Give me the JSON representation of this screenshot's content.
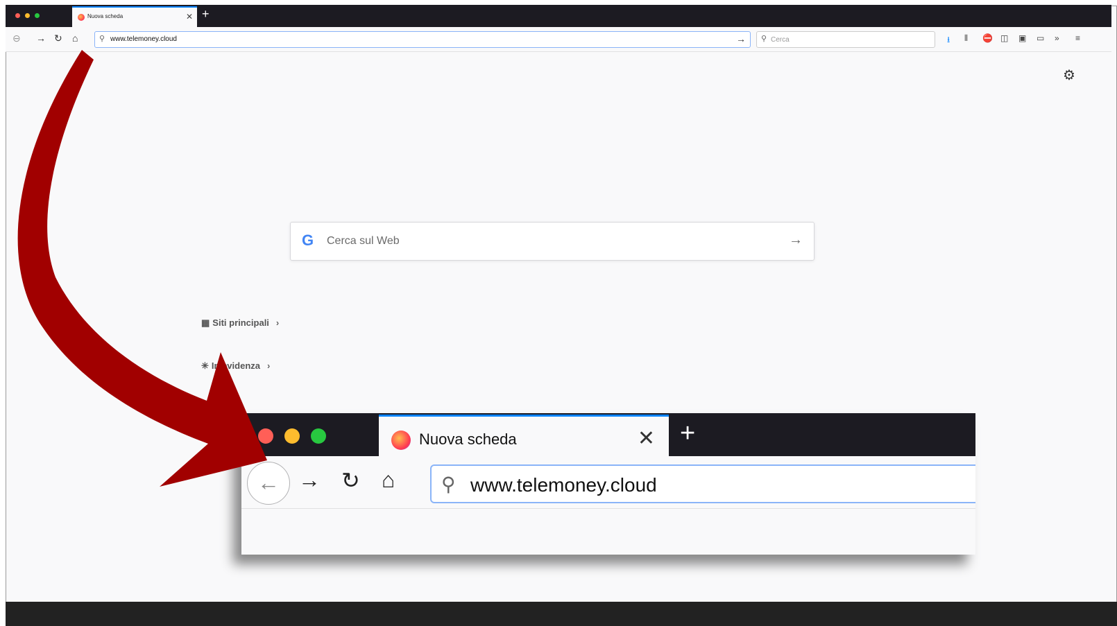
{
  "colors": {
    "accent": "#0a84ff",
    "arrow": "#a10000",
    "tabbar": "#1c1b22"
  },
  "browser": {
    "tab_title": "Nuova scheda",
    "url": "www.telemoney.cloud",
    "search_placeholder": "Cerca"
  },
  "newtab": {
    "web_search_placeholder": "Cerca sul Web",
    "google_logo": "G",
    "sections": [
      {
        "label": "Siti principali",
        "icon": "grid-icon"
      },
      {
        "label": "In evidenza",
        "icon": "highlights-icon"
      }
    ]
  },
  "zoom": {
    "tab_title": "Nuova scheda",
    "url": "www.telemoney.cloud"
  }
}
